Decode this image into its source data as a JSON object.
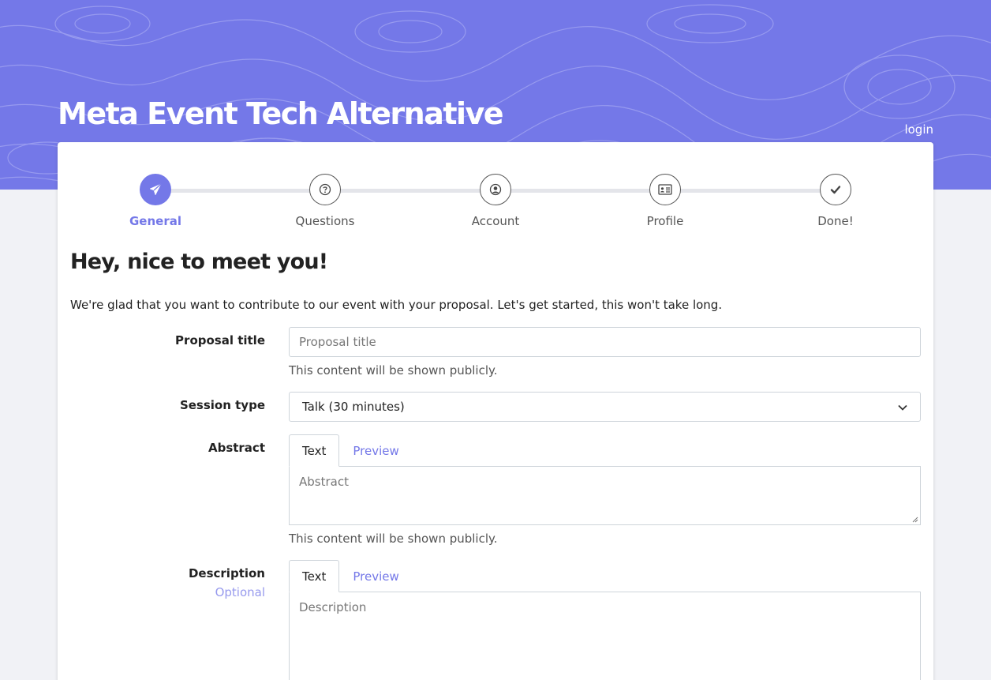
{
  "header": {
    "event_title": "Meta Event Tech Alternative",
    "login_label": "login",
    "accent_color": "#7478e8"
  },
  "stepper": {
    "steps": [
      {
        "label": "General",
        "icon": "paper-plane-icon",
        "active": true
      },
      {
        "label": "Questions",
        "icon": "question-circle-icon",
        "active": false
      },
      {
        "label": "Account",
        "icon": "user-circle-icon",
        "active": false
      },
      {
        "label": "Profile",
        "icon": "id-card-icon",
        "active": false
      },
      {
        "label": "Done!",
        "icon": "check-icon",
        "active": false
      }
    ]
  },
  "main": {
    "greeting": "Hey, nice to meet you!",
    "intro": "We're glad that you want to contribute to our event with your proposal. Let's get started, this won't take long."
  },
  "form": {
    "title": {
      "label": "Proposal title",
      "placeholder": "Proposal title",
      "help": "This content will be shown publicly."
    },
    "session_type": {
      "label": "Session type",
      "selected": "Talk (30 minutes)"
    },
    "abstract": {
      "label": "Abstract",
      "tab_text": "Text",
      "tab_preview": "Preview",
      "placeholder": "Abstract",
      "help": "This content will be shown publicly."
    },
    "description": {
      "label": "Description",
      "optional": "Optional",
      "tab_text": "Text",
      "tab_preview": "Preview",
      "placeholder": "Description"
    }
  }
}
